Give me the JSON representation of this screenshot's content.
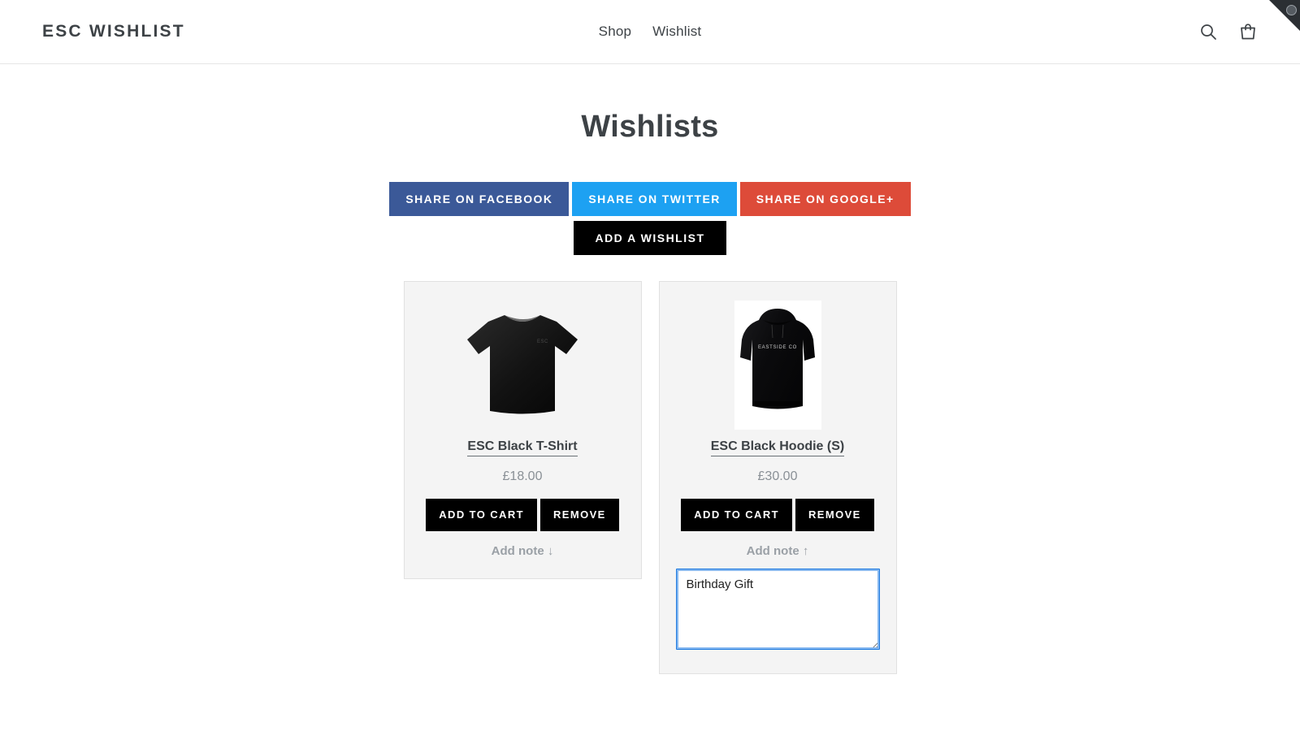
{
  "header": {
    "logo": "ESC WISHLIST",
    "nav": [
      {
        "label": "Shop"
      },
      {
        "label": "Wishlist"
      }
    ],
    "icons": [
      {
        "name": "search-icon"
      },
      {
        "name": "cart-icon"
      }
    ]
  },
  "page": {
    "title": "Wishlists"
  },
  "share": {
    "facebook": {
      "label": "SHARE ON FACEBOOK",
      "color": "#3b5998"
    },
    "twitter": {
      "label": "SHARE ON TWITTER",
      "color": "#1da1f2"
    },
    "googleplus": {
      "label": "SHARE ON GOOGLE+",
      "color": "#dd4b39"
    }
  },
  "actions": {
    "add_wishlist_label": "ADD A WISHLIST",
    "add_to_cart_label": "ADD TO CART",
    "remove_label": "REMOVE"
  },
  "cards": [
    {
      "title": "ESC Black T-Shirt",
      "price": "£18.00",
      "add_to_cart_label": "ADD TO CART",
      "remove_label": "REMOVE",
      "note_toggle_label": "Add note ↓",
      "note_expanded": false,
      "note_value": "",
      "image_alt": "black t-shirt with ESC chest logo",
      "image_chest_text": "ESC"
    },
    {
      "title": "ESC Black Hoodie (S)",
      "price": "£30.00",
      "add_to_cart_label": "ADD TO CART",
      "remove_label": "REMOVE",
      "note_toggle_label": "Add note ↑",
      "note_expanded": true,
      "note_value": "Birthday Gift",
      "image_alt": "black hoodie with EASTSIDE CO chest print",
      "image_chest_text": "EASTSIDE CO"
    }
  ],
  "theme": {
    "text": "#3d4246",
    "muted": "#8a9096",
    "card_bg": "#f4f4f4",
    "card_border": "#e1e1e1",
    "button_bg": "#000000",
    "focus_ring": "#86b8f0"
  }
}
